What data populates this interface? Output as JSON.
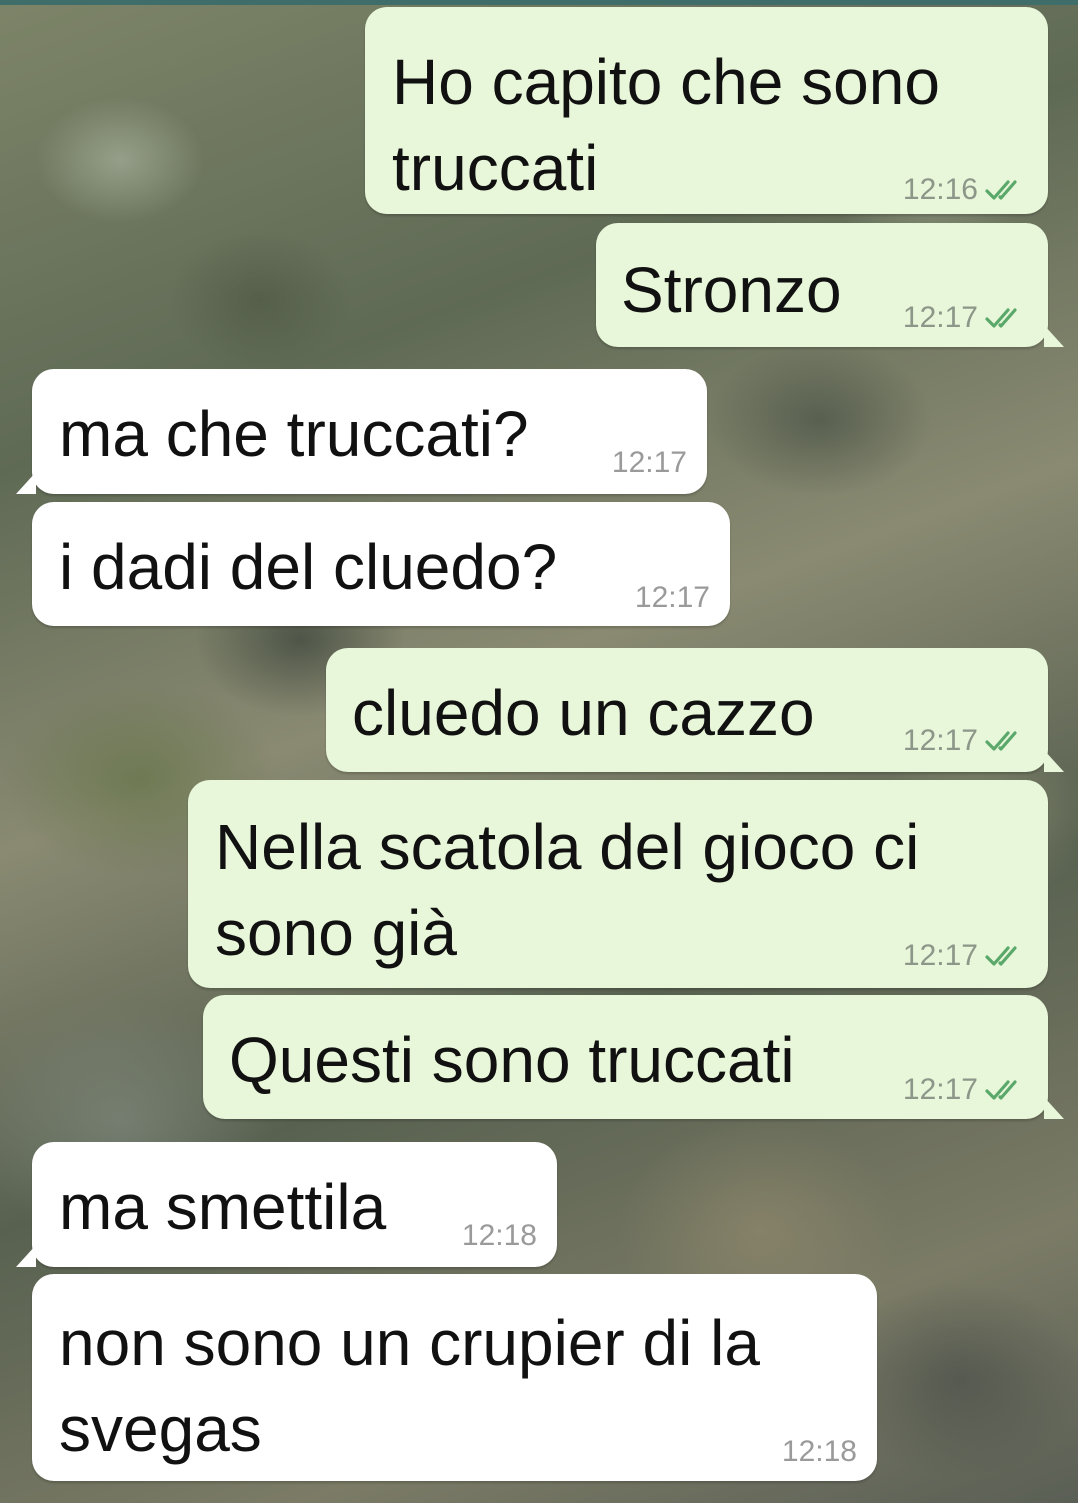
{
  "colors": {
    "outgoing_bubble": "#e8f6d9",
    "incoming_bubble": "#ffffff",
    "read_ticks": "#5aa86a",
    "timestamp_out": "#8c9689",
    "timestamp_in": "#9a9a9a"
  },
  "messages": [
    {
      "direction": "out",
      "text": "Ho capito che sono\ntruccati",
      "time": "12:16",
      "status_icon": "double-check-icon"
    },
    {
      "direction": "out",
      "text": "Stronzo",
      "time": "12:17",
      "status_icon": "double-check-icon"
    },
    {
      "direction": "in",
      "text": "ma che truccati?",
      "time": "12:17"
    },
    {
      "direction": "in",
      "text": "i dadi del cluedo?",
      "time": "12:17"
    },
    {
      "direction": "out",
      "text": "cluedo un cazzo",
      "time": "12:17",
      "status_icon": "double-check-icon"
    },
    {
      "direction": "out",
      "text": "Nella scatola del gioco ci\nsono già",
      "time": "12:17",
      "status_icon": "double-check-icon"
    },
    {
      "direction": "out",
      "text": "Questi sono truccati",
      "time": "12:17",
      "status_icon": "double-check-icon"
    },
    {
      "direction": "in",
      "text": "ma smettila",
      "time": "12:18"
    },
    {
      "direction": "in",
      "text": "non sono un crupier di la\nsvegas",
      "time": "12:18"
    }
  ]
}
